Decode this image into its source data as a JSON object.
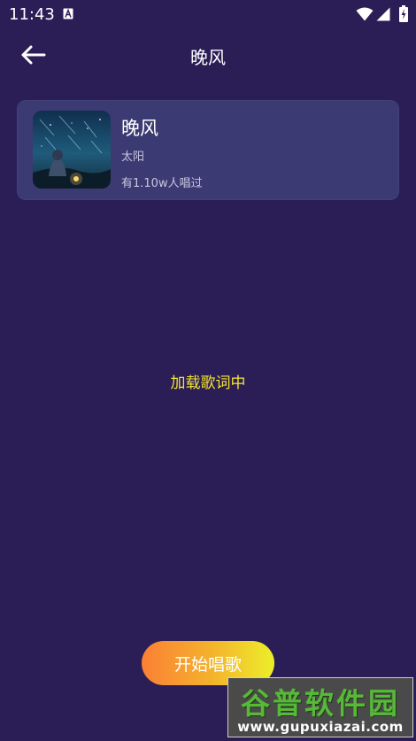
{
  "status_bar": {
    "time": "11:43",
    "icons": [
      "text-a-icon",
      "wifi-icon",
      "signal-icon",
      "battery-charging-icon"
    ]
  },
  "app_bar": {
    "back_icon": "arrow-left-icon",
    "title": "晚风"
  },
  "song": {
    "title": "晚风",
    "artist": "太阳",
    "sung_count": "有1.10w人唱过"
  },
  "loading_text": "加载歌词中",
  "start_button_label": "开始唱歌",
  "watermark": {
    "name": "谷普软件园",
    "url": "www.gupuxiazai.com"
  },
  "colors": {
    "background": "#2b1e57",
    "card": "#3b3a73",
    "loading_text": "#f5e52e",
    "button_gradient_start": "#fb7f35",
    "button_gradient_end": "#ecef2a"
  }
}
